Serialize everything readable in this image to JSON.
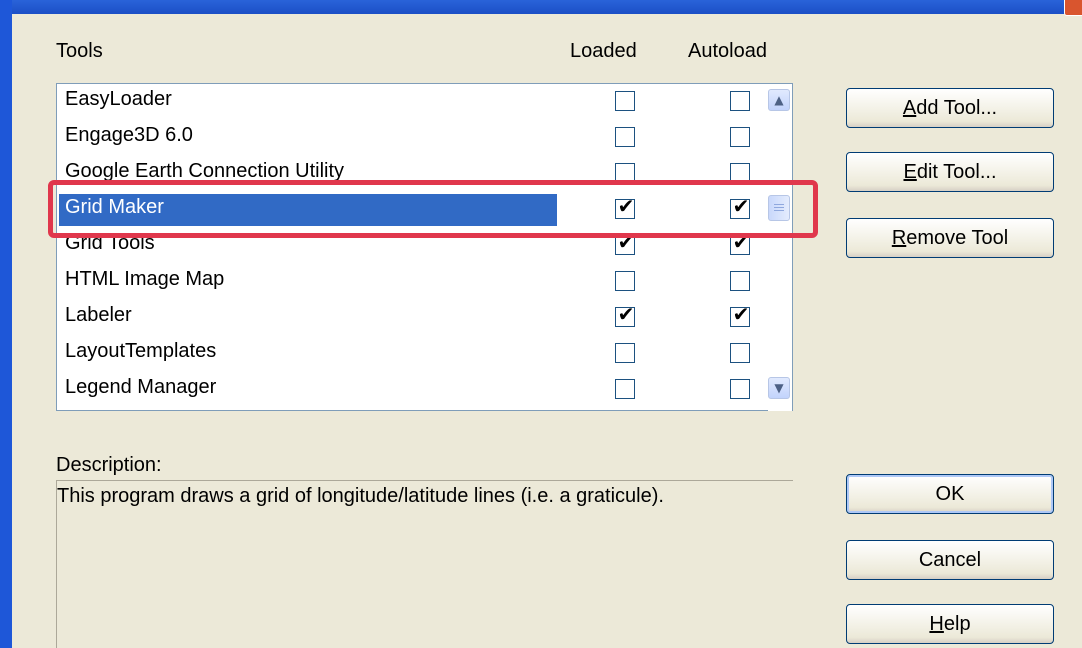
{
  "headers": {
    "tools": "Tools",
    "loaded": "Loaded",
    "autoload": "Autoload"
  },
  "tools": [
    {
      "name": "EasyLoader",
      "loaded": false,
      "autoload": false,
      "selected": false
    },
    {
      "name": "Engage3D 6.0",
      "loaded": false,
      "autoload": false,
      "selected": false
    },
    {
      "name": "Google Earth Connection Utility",
      "loaded": false,
      "autoload": false,
      "selected": false
    },
    {
      "name": "Grid Maker",
      "loaded": true,
      "autoload": true,
      "selected": true
    },
    {
      "name": "Grid Tools",
      "loaded": true,
      "autoload": true,
      "selected": false
    },
    {
      "name": "HTML Image Map",
      "loaded": false,
      "autoload": false,
      "selected": false
    },
    {
      "name": "Labeler",
      "loaded": true,
      "autoload": true,
      "selected": false
    },
    {
      "name": "LayoutTemplates",
      "loaded": false,
      "autoload": false,
      "selected": false
    },
    {
      "name": "Legend Manager",
      "loaded": false,
      "autoload": false,
      "selected": false
    }
  ],
  "buttons": {
    "add_tool": {
      "accel": "A",
      "rest": "dd Tool..."
    },
    "edit_tool": {
      "accel": "E",
      "rest": "dit Tool..."
    },
    "remove_tool": {
      "accel": "R",
      "rest": "emove Tool"
    },
    "ok": "OK",
    "cancel": "Cancel",
    "help": {
      "accel": "H",
      "rest": "elp"
    }
  },
  "description": {
    "label": "Description:",
    "text": "This program draws a grid of longitude/latitude lines (i.e. a graticule)."
  },
  "icons": {
    "scroll_up": "chevron-up-icon",
    "scroll_down": "chevron-down-icon",
    "check": "checkmark-icon"
  },
  "colors": {
    "selection": "#316ac5",
    "highlight_annotation": "#e0374c"
  }
}
